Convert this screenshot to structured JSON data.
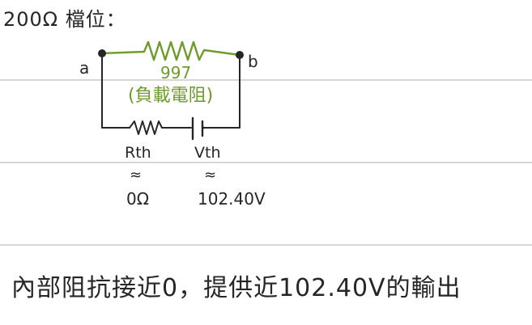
{
  "note": {
    "heading": "200Ω 檔位：",
    "labels": {
      "node_a": "a",
      "node_b": "b",
      "load_value": "997",
      "load_name": "(負載電阻)",
      "rth_label": "Rth",
      "vth_label": "Vth",
      "rth_approx": "≈",
      "vth_approx": "≈",
      "rth_value": "0Ω",
      "vth_value": "102.40V"
    },
    "conclusion": "內部阻抗接近0，提供近102.40V的輸出"
  },
  "colors": {
    "ink": "#262626",
    "load_resistor": "#6f9a2c",
    "ruled_lines": "#d6d6d6",
    "paper": "#ffffff"
  }
}
